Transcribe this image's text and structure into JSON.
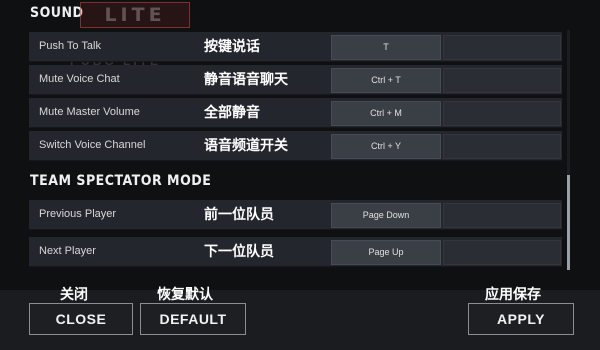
{
  "sections": {
    "sound_title": "SOUND",
    "team_title": "TEAM SPECTATOR MODE"
  },
  "watermark": {
    "logo": "LITE",
    "sub": "PUBG LITE"
  },
  "sound_rows": [
    {
      "label": "Push To Talk",
      "cn": "按键说话",
      "key": "T"
    },
    {
      "label": "Mute Voice Chat",
      "cn": "静音语音聊天",
      "key": "Ctrl + T"
    },
    {
      "label": "Mute Master Volume",
      "cn": "全部静音",
      "key": "Ctrl + M"
    },
    {
      "label": "Switch Voice Channel",
      "cn": "语音频道开关",
      "key": "Ctrl + Y"
    }
  ],
  "team_rows": [
    {
      "label": "Previous Player",
      "cn": "前一位队员",
      "key": "Page Down"
    },
    {
      "label": "Next Player",
      "cn": "下一位队员",
      "key": "Page Up"
    }
  ],
  "footer": {
    "close_cn": "关闭",
    "close": "CLOSE",
    "default_cn": "恢复默认",
    "default": "DEFAULT",
    "apply_cn": "应用保存",
    "apply": "APPLY"
  }
}
